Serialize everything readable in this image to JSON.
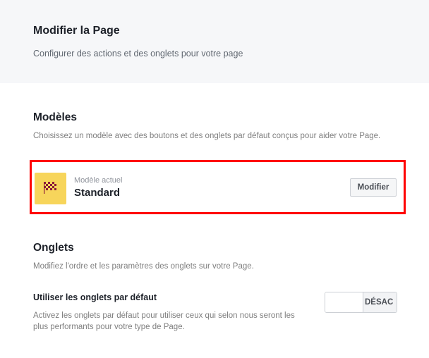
{
  "header": {
    "title": "Modifier la Page",
    "subtitle": "Configurer des actions et des onglets pour votre page"
  },
  "templates": {
    "title": "Modèles",
    "description": "Choisissez un modèle avec des boutons et des onglets par défaut conçus pour aider votre Page.",
    "current_caption": "Modèle actuel",
    "current_name": "Standard",
    "thumbnail_icon": "checkered-flag-icon",
    "modify_label": "Modifier",
    "highlight_color": "#ff0000"
  },
  "tabs": {
    "title": "Onglets",
    "description": "Modifiez l'ordre et les paramètres des onglets sur votre Page.",
    "default_tabs": {
      "title": "Utiliser les onglets par défaut",
      "description": "Activez les onglets par défaut pour utiliser ceux qui selon nous seront les plus performants pour votre type de Page.",
      "toggle_label": "DÉSAC",
      "toggle_state": "off"
    }
  }
}
